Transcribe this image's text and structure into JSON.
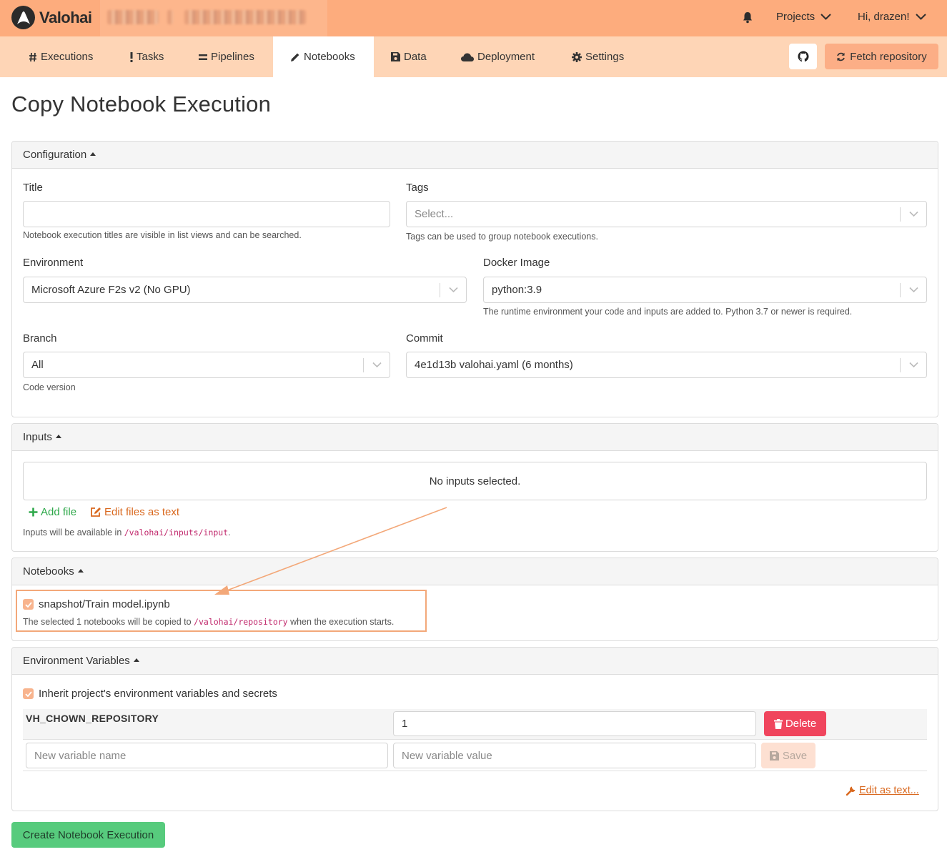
{
  "app": {
    "brand": "Valohai",
    "user_greeting": "Hi, drazen!",
    "projects_label": "Projects"
  },
  "nav": {
    "executions": "Executions",
    "tasks": "Tasks",
    "pipelines": "Pipelines",
    "notebooks": "Notebooks",
    "data": "Data",
    "deployment": "Deployment",
    "settings": "Settings",
    "fetch_repository": "Fetch repository"
  },
  "page": {
    "title": "Copy Notebook Execution"
  },
  "configuration": {
    "header": "Configuration",
    "title_label": "Title",
    "title_value": "",
    "title_help": "Notebook execution titles are visible in list views and can be searched.",
    "tags_label": "Tags",
    "tags_placeholder": "Select...",
    "tags_help": "Tags can be used to group notebook executions.",
    "environment_label": "Environment",
    "environment_value": "Microsoft Azure F2s v2 (No GPU)",
    "docker_label": "Docker Image",
    "docker_value": "python:3.9",
    "docker_help": "The runtime environment your code and inputs are added to. Python 3.7 or newer is required.",
    "branch_label": "Branch",
    "branch_value": "All",
    "branch_help": "Code version",
    "commit_label": "Commit",
    "commit_value": "4e1d13b valohai.yaml (6 months)"
  },
  "inputs": {
    "header": "Inputs",
    "empty_text": "No inputs selected.",
    "add_file": "Add file",
    "edit_as_text": "Edit files as text",
    "help_prefix": "Inputs will be available in ",
    "help_path": "/valohai/inputs/input",
    "help_suffix": "."
  },
  "notebooks": {
    "header": "Notebooks",
    "item": "snapshot/Train model.ipynb",
    "checked": true,
    "help_prefix": "The selected 1 notebooks will be copied to ",
    "help_path": "/valohai/repository",
    "help_suffix": " when the execution starts."
  },
  "env_vars": {
    "header": "Environment Variables",
    "inherit_label": "Inherit project's environment variables and secrets",
    "inherit_checked": true,
    "rows": [
      {
        "name": "VH_CHOWN_REPOSITORY",
        "value": "1"
      }
    ],
    "delete_label": "Delete",
    "new_name_placeholder": "New variable name",
    "new_value_placeholder": "New variable value",
    "save_label": "Save",
    "edit_as_text": "Edit as text..."
  },
  "actions": {
    "create": "Create Notebook Execution"
  },
  "colors": {
    "topbar": "#fdac7d",
    "navbar": "#fed5b6",
    "accent": "#f8b48e",
    "annotation": "#f3a879",
    "delete": "#f0455d",
    "create": "#57cb7d"
  }
}
